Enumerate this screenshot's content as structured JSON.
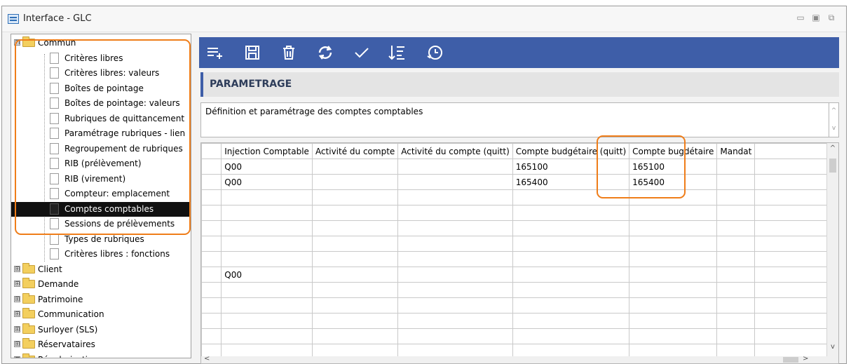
{
  "window": {
    "title": "Interface - GLC",
    "controls": {
      "minimize": "▭",
      "maximize": "▣",
      "close": "⧉"
    }
  },
  "tree": {
    "items": [
      {
        "label": "Commun",
        "type": "folder",
        "expander": "⊟",
        "level": 0
      },
      {
        "label": "Critères libres",
        "type": "page",
        "level": 1
      },
      {
        "label": "Critères libres: valeurs",
        "type": "page",
        "level": 1
      },
      {
        "label": "Boîtes de pointage",
        "type": "page",
        "level": 1
      },
      {
        "label": "Boîtes de pointage: valeurs",
        "type": "page",
        "level": 1
      },
      {
        "label": "Rubriques de quittancement",
        "type": "page",
        "level": 1
      },
      {
        "label": "Paramétrage rubriques - lien",
        "type": "page",
        "level": 1
      },
      {
        "label": "Regroupement de rubriques",
        "type": "page",
        "level": 1
      },
      {
        "label": "RIB (prélèvement)",
        "type": "page",
        "level": 1
      },
      {
        "label": "RIB (virement)",
        "type": "page",
        "level": 1
      },
      {
        "label": "Compteur: emplacement",
        "type": "page",
        "level": 1
      },
      {
        "label": "Comptes comptables",
        "type": "page",
        "level": 1,
        "selected": true
      },
      {
        "label": "Sessions de prélèvements",
        "type": "page",
        "level": 1
      },
      {
        "label": "Types de rubriques",
        "type": "page",
        "level": 1
      },
      {
        "label": "Critères libres : fonctions",
        "type": "page",
        "level": 1
      },
      {
        "label": "Client",
        "type": "folder",
        "expander": "⊞",
        "level": 0
      },
      {
        "label": "Demande",
        "type": "folder",
        "expander": "⊞",
        "level": 0
      },
      {
        "label": "Patrimoine",
        "type": "folder",
        "expander": "⊞",
        "level": 0
      },
      {
        "label": "Communication",
        "type": "folder",
        "expander": "⊞",
        "level": 0
      },
      {
        "label": "Surloyer (SLS)",
        "type": "folder",
        "expander": "⊞",
        "level": 0
      },
      {
        "label": "Réservataires",
        "type": "folder",
        "expander": "⊞",
        "level": 0
      },
      {
        "label": "Régularisation",
        "type": "folder",
        "expander": "⊞",
        "level": 0
      }
    ]
  },
  "toolbar": {
    "buttons": [
      {
        "name": "add-row-icon"
      },
      {
        "name": "save-icon"
      },
      {
        "name": "delete-icon"
      },
      {
        "name": "refresh-icon"
      },
      {
        "name": "validate-icon"
      },
      {
        "name": "sort-icon"
      },
      {
        "name": "history-icon"
      }
    ],
    "color": "#3e5ea8"
  },
  "section": {
    "title": "PARAMETRAGE"
  },
  "description": "Définition et paramétrage des comptes comptables",
  "grid": {
    "columns": [
      "Injection Comptable",
      "Activité du compte",
      "Activité du compte (quitt)",
      "Compte budgétaire (quitt)",
      "Compte bugdétaire",
      "Mandat"
    ],
    "rows": [
      [
        "Q00",
        "",
        "",
        "165100",
        "165100",
        ""
      ],
      [
        "Q00",
        "",
        "",
        "165400",
        "165400",
        ""
      ],
      [
        "",
        "",
        "",
        "",
        "",
        ""
      ],
      [
        "",
        "",
        "",
        "",
        "",
        ""
      ],
      [
        "",
        "",
        "",
        "",
        "",
        ""
      ],
      [
        "",
        "",
        "",
        "",
        "",
        ""
      ],
      [
        "",
        "",
        "",
        "",
        "",
        ""
      ],
      [
        "Q00",
        "",
        "",
        "",
        "",
        ""
      ],
      [
        "",
        "",
        "",
        "",
        "",
        ""
      ],
      [
        "",
        "",
        "",
        "",
        "",
        ""
      ],
      [
        "",
        "",
        "",
        "",
        "",
        ""
      ],
      [
        "",
        "",
        "",
        "",
        "",
        ""
      ],
      [
        "",
        "",
        "",
        "",
        "",
        ""
      ],
      [
        "",
        "",
        "",
        "",
        "",
        ""
      ]
    ],
    "scroll": {
      "up": "^",
      "down": "v",
      "left": "<",
      "right": ">"
    }
  },
  "accent": "#ef7d19"
}
